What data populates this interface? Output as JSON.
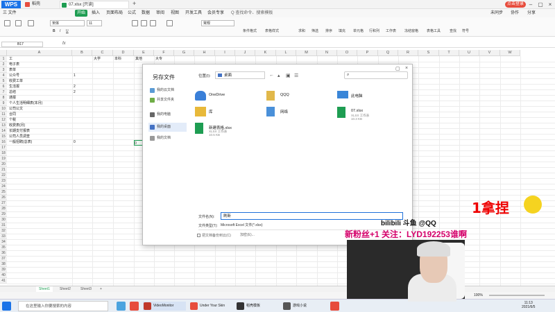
{
  "app": {
    "logo": "WPS",
    "tabs": [
      {
        "label": "稻壳",
        "color": "#e74c3c"
      },
      {
        "label": "07.xlsx [只读]",
        "color": "#1e9d52"
      }
    ],
    "account": "点击登录",
    "add_tab": "+"
  },
  "menu": {
    "items": [
      "三 文件",
      "开始",
      "插入",
      "页面布局",
      "公式",
      "数据",
      "审阅",
      "视图",
      "开发工具",
      "会员专享",
      "Q 查找命令、搜索模板"
    ],
    "active": "开始",
    "right": [
      "未同步",
      "协作",
      "分享"
    ]
  },
  "ribbon": {
    "font": "宋体",
    "size": "11",
    "number_format": "常规",
    "groups": [
      "条件格式",
      "表格样式",
      "求和",
      "筛选",
      "排序",
      "填充",
      "单元格",
      "行和列",
      "工作表",
      "冻结窗格",
      "表格工具",
      "查找",
      "符号"
    ]
  },
  "formula_bar": {
    "name_box": "B17",
    "fx": "fx"
  },
  "grid": {
    "columns": [
      "A",
      "B",
      "C",
      "D",
      "E",
      "F",
      "G",
      "H",
      "I",
      "J",
      "K",
      "L",
      "M",
      "N",
      "O",
      "P",
      "Q",
      "R",
      "S",
      "T",
      "U",
      "V",
      "W"
    ],
    "header_row": [
      "",
      "",
      "大学",
      "本科",
      "其他",
      "大专",
      "",
      "",
      ""
    ],
    "col_a": [
      "工",
      "电子表",
      "表单",
      "公众号",
      "收费工单",
      "生活报",
      "总结",
      "通报",
      "个人生活明细表(本月)",
      "公司公文",
      "合同",
      "个税",
      "收费表(月)",
      "长期支付报表",
      "公司人员调查",
      "一般招聘(总表)"
    ],
    "col_b": [
      "",
      "",
      "",
      "1",
      "",
      "2",
      "2",
      "",
      "",
      "",
      "",
      "",
      "",
      "",
      "",
      "0",
      ""
    ],
    "row_count": 41,
    "selected_cell": "B17",
    "selected_value": "0"
  },
  "sheets": {
    "tabs": [
      "Sheet1",
      "Sheet2",
      "Sheet3"
    ],
    "active": "Sheet1",
    "add": "+"
  },
  "status": {
    "zoom": "100%"
  },
  "dialog": {
    "title": "另存文件",
    "sidebar": [
      "我的云文档",
      "共享文件夹",
      "我的电脑",
      "我的桌面",
      "我的文档"
    ],
    "active_side": "我的桌面",
    "location_label": "位置(I):",
    "location_value": "桌面",
    "files": [
      {
        "name": "OneDrive",
        "size": "",
        "type": "folder-cloud"
      },
      {
        "name": "QQQ",
        "size": "",
        "type": "user"
      },
      {
        "name": "此电脑",
        "size": "",
        "type": "computer"
      },
      {
        "name": "库",
        "size": "",
        "type": "folder"
      },
      {
        "name": "网络",
        "size": "",
        "type": "network"
      },
      {
        "name": "07.xlsx",
        "size": "XLSX 工作表\n10.3 KB",
        "type": "xlsx"
      },
      {
        "name": "新建表格.xlsx",
        "size": "XLSX 工作表\n10.5 KB",
        "type": "xlsx"
      }
    ],
    "filename_label": "文件名(N):",
    "filename_value": "刷新",
    "filetype_label": "文件类型(T):",
    "filetype_value": "Microsoft Excel 文件(*.xlsx)",
    "encrypt": "把文档备份到云(C)",
    "cloud_label": "加密(E)..."
  },
  "overlays": {
    "big_text": "1拿捏",
    "id_text": "bilibili 斗鱼 @QQ",
    "promo": "新粉丝+1 关注：LYD192253谁啊"
  },
  "taskbar": {
    "search": "在这里输入你要搜索的内容",
    "apps": [
      "VideoMonitor",
      "Under Your Skin",
      "稻壳模板",
      "游戏小说"
    ],
    "time": "11:13",
    "date": "2021/6/5"
  }
}
